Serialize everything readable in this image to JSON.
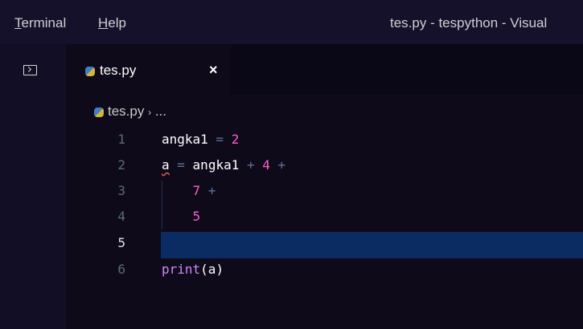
{
  "menu": {
    "items": [
      {
        "label": "Terminal",
        "mnemonic": "T",
        "rest": "erminal"
      },
      {
        "label": "Help",
        "mnemonic": "H",
        "rest": "elp"
      }
    ],
    "window_title": "tes.py - tespython - Visual"
  },
  "activity": {
    "icon": "panel-icon"
  },
  "tabs": [
    {
      "label": "tes.py",
      "icon": "python-file-icon",
      "close": "×"
    }
  ],
  "breadcrumb": {
    "file": "tes.py",
    "separator": "›",
    "rest": "..."
  },
  "editor": {
    "current_line": 5,
    "lines": [
      {
        "no": "1",
        "tokens": [
          {
            "t": "angka1",
            "k": "id"
          },
          {
            "t": " = ",
            "k": "op"
          },
          {
            "t": "2",
            "k": "num"
          }
        ]
      },
      {
        "no": "2",
        "tokens": [
          {
            "t": "a",
            "k": "err"
          },
          {
            "t": " = ",
            "k": "op"
          },
          {
            "t": "angka1",
            "k": "id"
          },
          {
            "t": " + ",
            "k": "op"
          },
          {
            "t": "4",
            "k": "num"
          },
          {
            "t": " +",
            "k": "op"
          }
        ]
      },
      {
        "no": "3",
        "tokens": [
          {
            "t": "    ",
            "k": "id"
          },
          {
            "t": "7",
            "k": "num"
          },
          {
            "t": " +",
            "k": "op"
          }
        ]
      },
      {
        "no": "4",
        "tokens": [
          {
            "t": "    ",
            "k": "id"
          },
          {
            "t": "5",
            "k": "num"
          }
        ]
      },
      {
        "no": "5",
        "tokens": []
      },
      {
        "no": "6",
        "tokens": [
          {
            "t": "print",
            "k": "fn"
          },
          {
            "t": "(a)",
            "k": "id"
          }
        ]
      }
    ]
  },
  "colors": {
    "background": "#0e0a19",
    "number": "#ff5fd2",
    "function": "#d488ff",
    "current_line": "#0b2b63"
  }
}
